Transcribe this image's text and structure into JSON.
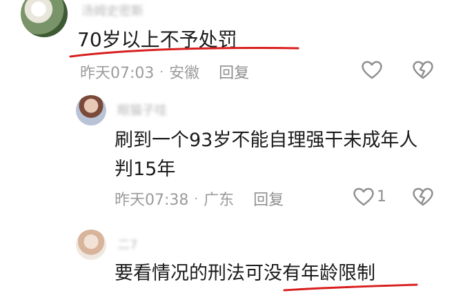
{
  "comments": [
    {
      "username": "汤姆史密斯",
      "text": "70岁以上不予处罚",
      "time": "昨天07:03",
      "location": "安徽",
      "reply_label": "回复",
      "like_count": ""
    },
    {
      "username": "眼猫子哇",
      "text_line1": "刷到一个93岁不能自理强干未成年人",
      "text_line2": "判15年",
      "time": "昨天07:38",
      "location": "广东",
      "reply_label": "回复",
      "like_count": "1"
    },
    {
      "username": "二7",
      "text": "要看情况的刑法可没有年龄限制"
    }
  ],
  "separator": "·",
  "colors": {
    "annotation_underline": "#d81e1e"
  },
  "icons": {
    "like": "heart-outline-icon",
    "dislike": "broken-heart-icon"
  }
}
